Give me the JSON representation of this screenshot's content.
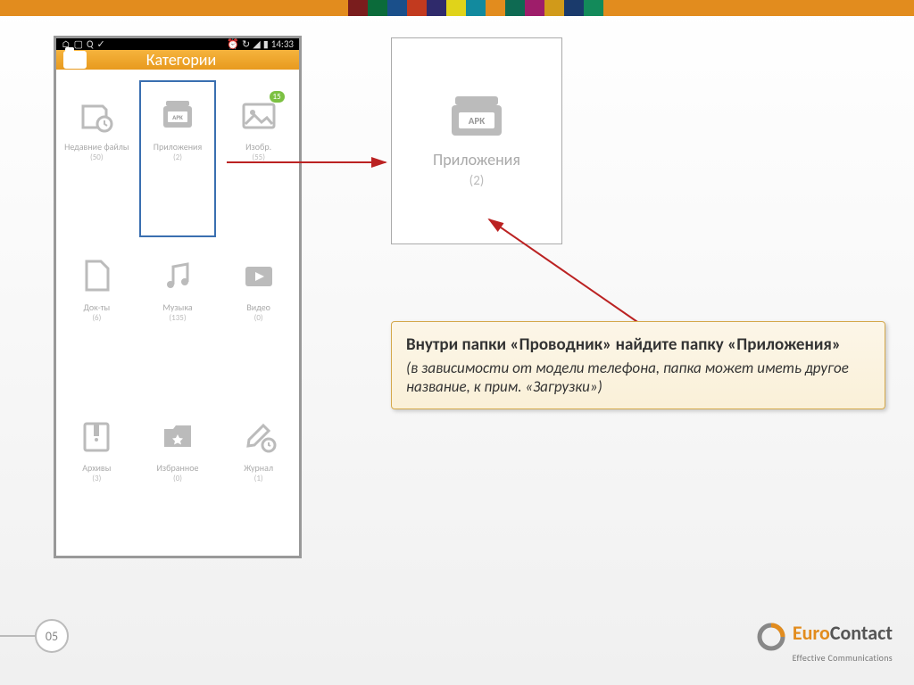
{
  "stripe_colors": [
    "#7a1d1d",
    "#0b6b3a",
    "#1a4f8a",
    "#c23a1f",
    "#2f2a6b",
    "#e0d31a",
    "#128a9e",
    "#e28c1e",
    "#0e6a52",
    "#9e1d6a",
    "#d19a1a",
    "#1a3a6b",
    "#138a5a"
  ],
  "statusbar": {
    "time": "14:33",
    "left_icons": [
      "home",
      "calendar",
      "search",
      "chevron"
    ],
    "right_icons": [
      "alarm",
      "sync",
      "signal",
      "battery"
    ]
  },
  "appbar": {
    "title": "Категории"
  },
  "grid": [
    {
      "name": "recent",
      "label": "Недавние файлы",
      "count": "(50)"
    },
    {
      "name": "apps",
      "label": "Приложения",
      "count": "(2)",
      "selected": true
    },
    {
      "name": "images",
      "label": "Изобр.",
      "count": "(55)",
      "badge": "15"
    },
    {
      "name": "docs",
      "label": "Док-ты",
      "count": "(6)"
    },
    {
      "name": "music",
      "label": "Музыка",
      "count": "(135)"
    },
    {
      "name": "video",
      "label": "Видео",
      "count": "(0)"
    },
    {
      "name": "archives",
      "label": "Архивы",
      "count": "(3)"
    },
    {
      "name": "favorites",
      "label": "Избранное",
      "count": "(0)"
    },
    {
      "name": "log",
      "label": "Журнал",
      "count": "(1)"
    }
  ],
  "zoom": {
    "label": "Приложения",
    "count": "(2)",
    "apk_text": "APK"
  },
  "callout": {
    "line1": "Внутри папки «Проводник» найдите папку «Приложения»",
    "line2": "(в зависимости от модели телефона, папка может иметь другое название, к прим. «Загрузки»)"
  },
  "page_number": "05",
  "logo": {
    "brand1": "Euro",
    "brand2": "Contact",
    "tag": "Effective Communications"
  }
}
